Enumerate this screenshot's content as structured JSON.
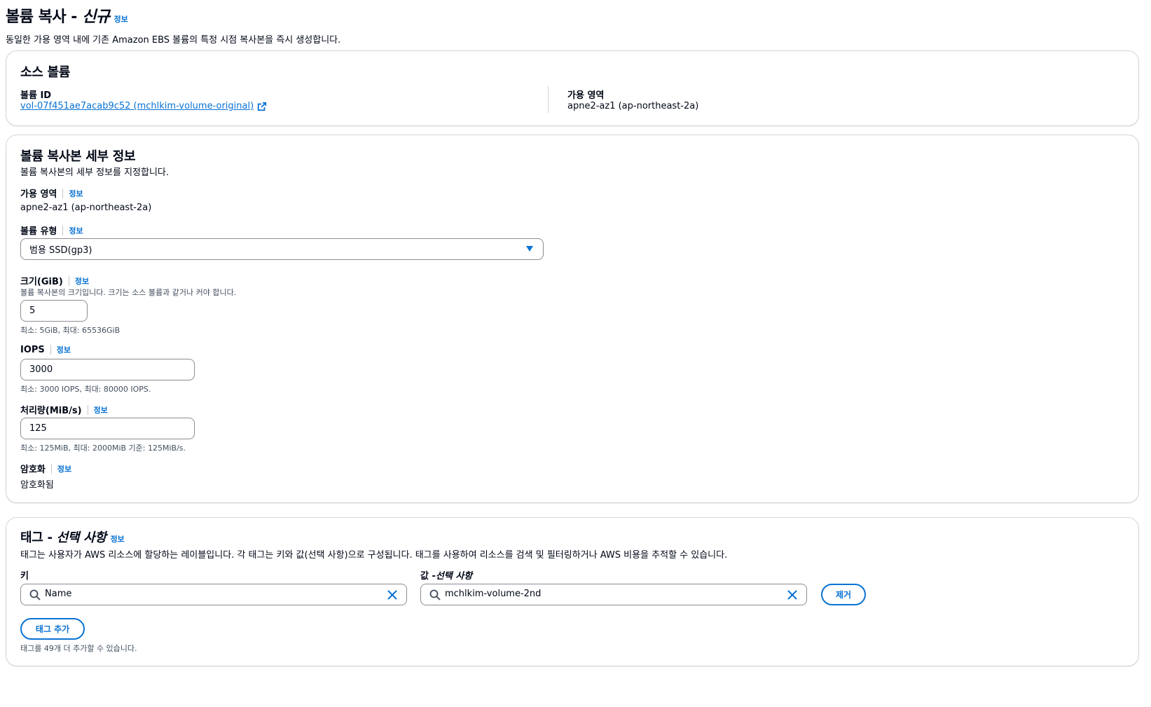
{
  "header": {
    "title_main": "볼륨 복사 - ",
    "title_em": "신규",
    "info": "정보",
    "description": "동일한 가용 영역 내에 기존 Amazon EBS 볼륨의 특정 시점 복사본을 즉시 생성합니다."
  },
  "source": {
    "title": "소스 볼륨",
    "volume_id_label": "볼륨 ID",
    "volume_id_link": "vol-07f451ae7acab9c52 (mchlkim-volume-original)",
    "az_label": "가용 영역",
    "az_value": "apne2-az1 (ap-northeast-2a)"
  },
  "details": {
    "title": "볼륨 복사본 세부 정보",
    "description": "볼륨 복사본의 세부 정보를 지정합니다.",
    "info": "정보",
    "az_label": "가용 영역",
    "az_value": "apne2-az1 (ap-northeast-2a)",
    "type_label": "볼륨 유형",
    "type_value": "범용 SSD(gp3)",
    "size_label": "크기(GiB)",
    "size_desc": "볼륨 복사본의 크기입니다. 크기는 소스 볼륨과 같거나 커야 합니다.",
    "size_value": "5",
    "size_hint": "최소: 5GiB, 최대: 65536GiB",
    "iops_label": "IOPS",
    "iops_value": "3000",
    "iops_hint": "최소: 3000 IOPS, 최대: 80000 IOPS.",
    "throughput_label": "처리량(MiB/s)",
    "throughput_value": "125",
    "throughput_hint": "최소: 125MiB, 최대: 2000MiB 기준: 125MiB/s.",
    "encryption_label": "암호화",
    "encryption_value": "암호화됨"
  },
  "tags": {
    "title_main": "태그 - ",
    "title_em": "선택 사항",
    "info": "정보",
    "description": "태그는 사용자가 AWS 리소스에 할당하는 레이블입니다. 각 태그는 키와 값(선택 사항)으로 구성됩니다. 태그를 사용하여 리소스를 검색 및 필터링하거나 AWS 비용을 추적할 수 있습니다.",
    "key_label": "키",
    "value_label_main": "값 - ",
    "value_label_em": "선택 사항",
    "key_value": "Name",
    "value_value": "mchlkim-volume-2nd",
    "remove_button": "제거",
    "add_button": "태그 추가",
    "remaining_hint": "태그를 49개 더 추가할 수 있습니다."
  },
  "colors": {
    "link": "#0972d3",
    "text": "#000716",
    "border": "#8c8c94"
  }
}
